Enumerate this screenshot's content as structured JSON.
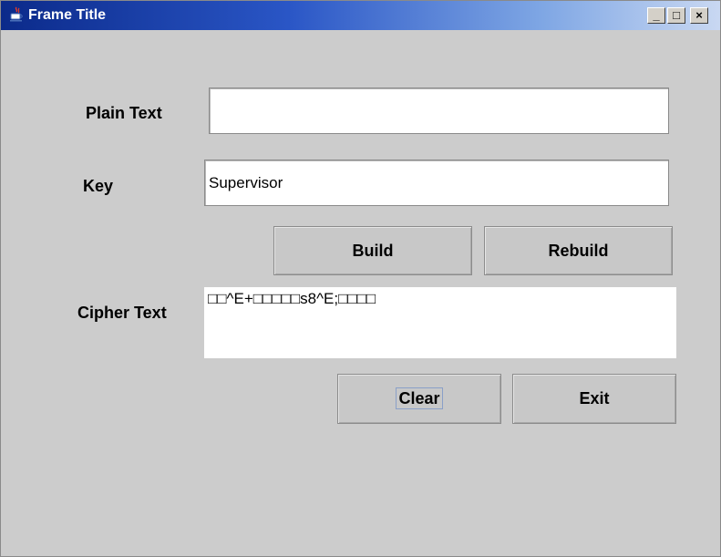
{
  "window": {
    "title": "Frame Title",
    "controls": {
      "minimize": "_",
      "maximize": "□",
      "close": "×"
    }
  },
  "form": {
    "plain_text": {
      "label": "Plain Text",
      "value": ""
    },
    "key": {
      "label": "Key",
      "value": "Supervisor"
    },
    "cipher_text": {
      "label": "Cipher Text",
      "value": "□□^E+□□□□□s8^E;□□□□"
    }
  },
  "buttons": {
    "build": "Build",
    "rebuild": "Rebuild",
    "clear": "Clear",
    "exit": "Exit"
  },
  "icons": {
    "app": "java-cup-icon"
  }
}
